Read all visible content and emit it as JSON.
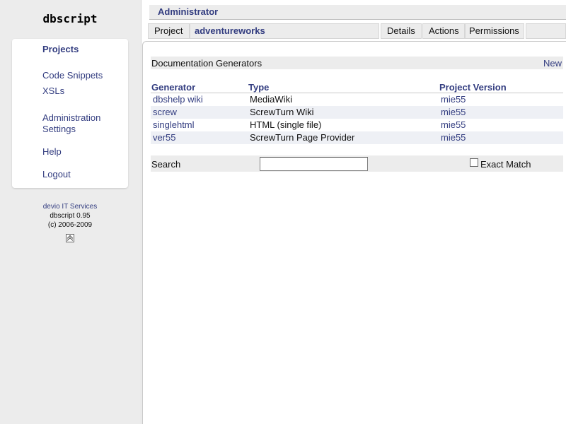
{
  "app": {
    "title": "dbscript"
  },
  "sidebar": {
    "items": [
      {
        "label": "Projects"
      },
      {
        "label": "Code Snippets"
      },
      {
        "label": "XSLs"
      },
      {
        "label": "Administration"
      },
      {
        "label": "Settings"
      },
      {
        "label": "Help"
      },
      {
        "label": "Logout"
      }
    ],
    "footer": {
      "company": "devio IT Services",
      "version": "dbscript 0.95",
      "copyright": "(c) 2006-2009",
      "icon": "scroll-to-top-icon"
    }
  },
  "header": {
    "user": "Administrator",
    "tabs": {
      "project_label": "Project",
      "project_name": "adventureworks",
      "details": "Details",
      "actions": "Actions",
      "permissions": "Permissions"
    }
  },
  "section": {
    "title": "Documentation Generators",
    "new_label": "New"
  },
  "table": {
    "columns": [
      "Generator",
      "Type",
      "Project Version"
    ],
    "rows": [
      {
        "generator": "dbshelp wiki",
        "type": "MediaWiki",
        "version": "mie55"
      },
      {
        "generator": "screw",
        "type": "ScrewTurn Wiki",
        "version": "mie55"
      },
      {
        "generator": "singlehtml",
        "type": "HTML (single file)",
        "version": "mie55"
      },
      {
        "generator": "ver55",
        "type": "ScrewTurn Page Provider",
        "version": "mie55"
      }
    ]
  },
  "search": {
    "label": "Search",
    "value": "",
    "exact_match_label": "Exact Match",
    "exact_match_checked": false
  },
  "colors": {
    "accent": "#333d80",
    "panel": "#ececec",
    "alt_row": "#eef0f5"
  }
}
